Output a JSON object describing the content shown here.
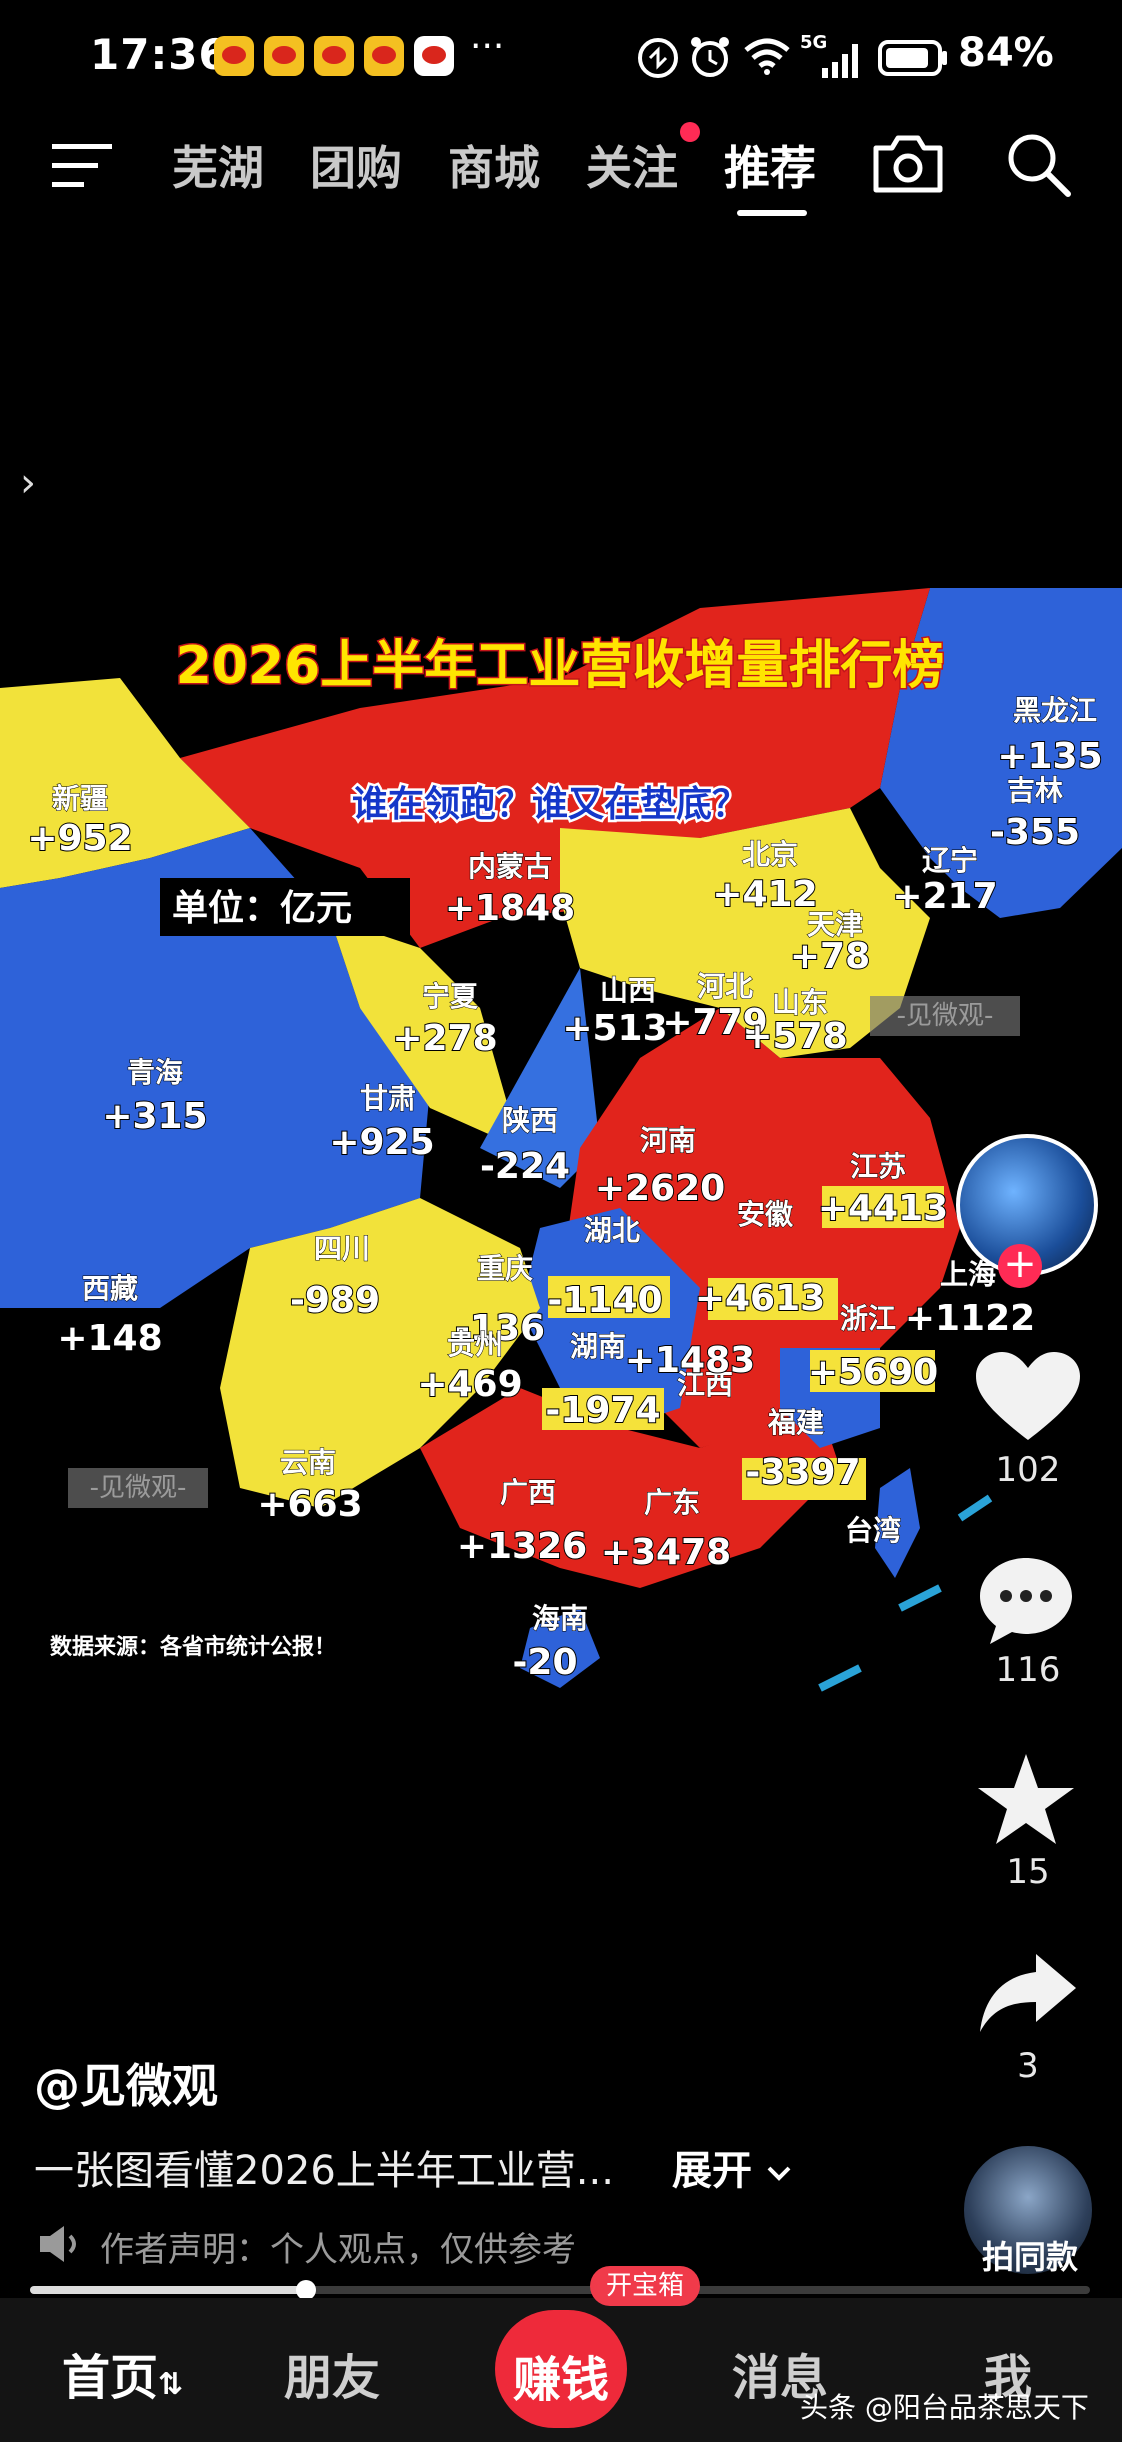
{
  "status_bar": {
    "time": "17:36",
    "more": "···",
    "network": "5G",
    "battery": "84%"
  },
  "top_nav": {
    "tabs": [
      "芜湖",
      "团购",
      "商城",
      "关注",
      "推荐"
    ],
    "active_tab": "推荐",
    "icons": [
      "menu-icon",
      "camera-icon",
      "search-icon"
    ]
  },
  "side_arrow": "›",
  "map": {
    "title": "2026上半年工业营收增量排行榜",
    "subtitle": "谁在领跑？谁又在垫底？",
    "unit": "单位：亿元",
    "source": "数据来源：各省市统计公报！",
    "watermark": "-见微观-",
    "colors": {
      "red": "#e1241c",
      "blue": "#2e62d9",
      "yellow": "#f2e23a"
    },
    "regions": [
      {
        "name": "新疆",
        "value": "+952"
      },
      {
        "name": "内蒙古",
        "value": "+1848"
      },
      {
        "name": "黑龙江",
        "value": "+135"
      },
      {
        "name": "吉林",
        "value": "-355"
      },
      {
        "name": "辽宁",
        "value": "+217"
      },
      {
        "name": "北京",
        "value": "+412"
      },
      {
        "name": "天津",
        "value": "+78"
      },
      {
        "name": "河北",
        "value": "+779"
      },
      {
        "name": "山西",
        "value": "+513"
      },
      {
        "name": "山东",
        "value": "+578"
      },
      {
        "name": "宁夏",
        "value": "+278"
      },
      {
        "name": "青海",
        "value": "+315"
      },
      {
        "name": "甘肃",
        "value": "+925"
      },
      {
        "name": "陕西",
        "value": "-224"
      },
      {
        "name": "河南",
        "value": "+2620"
      },
      {
        "name": "江苏",
        "value": "+4413"
      },
      {
        "name": "安徽",
        "value": "+4613"
      },
      {
        "name": "湖北",
        "value": "-1140"
      },
      {
        "name": "上海",
        "value": "+1122"
      },
      {
        "name": "浙江",
        "value": "+5690"
      },
      {
        "name": "四川",
        "value": "-989"
      },
      {
        "name": "重庆",
        "value": "-136"
      },
      {
        "name": "西藏",
        "value": "+148"
      },
      {
        "name": "湖南",
        "value": "-1974"
      },
      {
        "name": "贵州",
        "value": "+469"
      },
      {
        "name": "江西",
        "value": "+1483"
      },
      {
        "name": "福建",
        "value": "-3397"
      },
      {
        "name": "云南",
        "value": "+663"
      },
      {
        "name": "广西",
        "value": "+1326"
      },
      {
        "name": "广东",
        "value": "+3478"
      },
      {
        "name": "台湾",
        "value": ""
      },
      {
        "name": "海南",
        "value": "-20"
      }
    ]
  },
  "actions": {
    "likes": "102",
    "comments": "116",
    "favorites": "15",
    "shares": "3",
    "same_style": "拍同款"
  },
  "caption": {
    "author": "@见微观",
    "description": "一张图看懂2026上半年工业营...",
    "expand": "展开",
    "notice": "作者声明：个人观点，仅供参考"
  },
  "progress": {
    "fraction": 0.26
  },
  "bottom_nav": {
    "home": "首页",
    "friends": "朋友",
    "earn": "赚钱",
    "chest": "开宝箱",
    "messages": "消息",
    "me": "我"
  },
  "watermark_text": "头条 @阳台品茶思天下"
}
